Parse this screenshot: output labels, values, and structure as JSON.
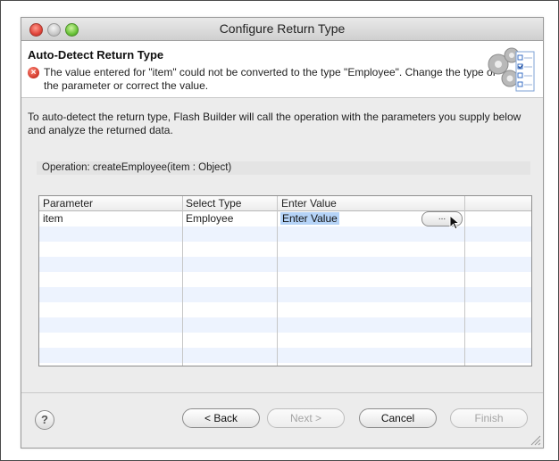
{
  "window": {
    "title": "Configure Return Type"
  },
  "header": {
    "title": "Auto-Detect Return Type",
    "error_message": "The value entered for \"item\" could not be converted to the type \"Employee\". Change the type of the parameter or correct the value."
  },
  "intro_text": "To auto-detect the return type, Flash Builder will call the operation with the parameters you supply below and analyze the returned data.",
  "operation": {
    "label": "Operation:",
    "value": "createEmployee(item : Object)"
  },
  "table": {
    "columns": [
      "Parameter",
      "Select Type",
      "Enter Value"
    ],
    "rows": [
      {
        "parameter": "item",
        "type": "Employee",
        "value": "Enter Value",
        "button": "..."
      }
    ]
  },
  "buttons": {
    "help": "?",
    "back": "< Back",
    "next": "Next >",
    "cancel": "Cancel",
    "finish": "Finish"
  },
  "icons": [
    "close-icon",
    "minimize-icon",
    "zoom-icon",
    "error-icon",
    "wizard-gear-checklist-icon",
    "pointer-cursor-icon",
    "resize-grip-icon"
  ],
  "colors": {
    "error_red": "#d23a2c",
    "selection_blue": "#b5d3f7",
    "alt_row": "#edf3fe"
  }
}
